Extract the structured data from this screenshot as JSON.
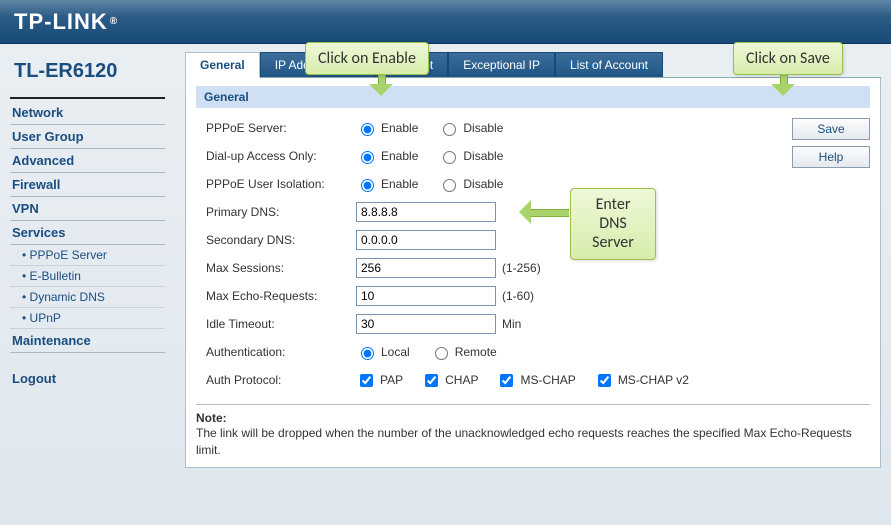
{
  "brand": "TP-LINK",
  "brand_reg": "®",
  "model": "TL-ER6120",
  "sidebar": {
    "items": [
      "Network",
      "User Group",
      "Advanced",
      "Firewall",
      "VPN",
      "Services"
    ],
    "sub_items": [
      "PPPoE Server",
      "E-Bulletin",
      "Dynamic DNS",
      "UPnP"
    ],
    "after_sub": [
      "Maintenance"
    ],
    "logout": "Logout"
  },
  "tabs": [
    "General",
    "IP Address Pool",
    "Account",
    "Exceptional IP",
    "List of Account"
  ],
  "section_title": "General",
  "form": {
    "pppoe_server": {
      "label": "PPPoE Server:",
      "enable": "Enable",
      "disable": "Disable",
      "value": "enable"
    },
    "dial_up": {
      "label": "Dial-up Access Only:",
      "enable": "Enable",
      "disable": "Disable",
      "value": "enable"
    },
    "isolation": {
      "label": "PPPoE User Isolation:",
      "enable": "Enable",
      "disable": "Disable",
      "value": "enable"
    },
    "primary_dns": {
      "label": "Primary DNS:",
      "value": "8.8.8.8"
    },
    "secondary_dns": {
      "label": "Secondary DNS:",
      "value": "0.0.0.0"
    },
    "max_sessions": {
      "label": "Max Sessions:",
      "value": "256",
      "hint": "(1-256)"
    },
    "max_echo": {
      "label": "Max Echo-Requests:",
      "value": "10",
      "hint": "(1-60)"
    },
    "idle_timeout": {
      "label": "Idle Timeout:",
      "value": "30",
      "hint": "Min"
    },
    "authentication": {
      "label": "Authentication:",
      "local": "Local",
      "remote": "Remote",
      "value": "local"
    },
    "auth_protocol": {
      "label": "Auth Protocol:",
      "options": [
        {
          "label": "PAP",
          "checked": true
        },
        {
          "label": "CHAP",
          "checked": true
        },
        {
          "label": "MS-CHAP",
          "checked": true
        },
        {
          "label": "MS-CHAP v2",
          "checked": true
        }
      ]
    }
  },
  "buttons": {
    "save": "Save",
    "help": "Help"
  },
  "note": {
    "title": "Note:",
    "body": "The link will be dropped when the number of the unacknowledged echo requests reaches the specified Max Echo-Requests limit."
  },
  "callouts": {
    "enable": "Click on Enable",
    "save": "Click on Save",
    "dns": "Enter DNS Server"
  }
}
